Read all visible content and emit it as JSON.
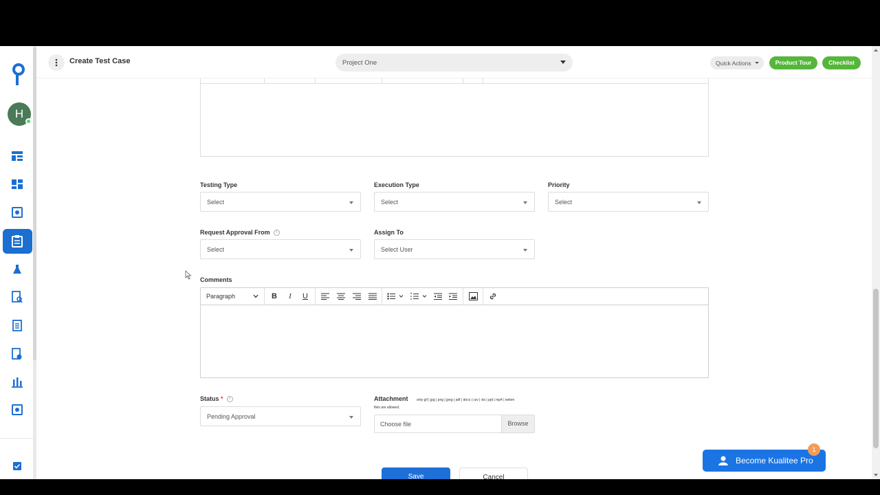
{
  "app": {
    "title": "Create Test Case",
    "avatar_initial": "H",
    "accent_color": "#1b6fd1",
    "green_color": "#55b63a"
  },
  "header": {
    "project": "Project One",
    "quick_actions": "Quick Actions",
    "product_tour": "Product Tour",
    "checklist": "Checklist"
  },
  "sidebar": {
    "icons": [
      "layout-icon",
      "dashboard-icon",
      "settings-doc-icon",
      "test-cases-icon",
      "flask-icon",
      "doc-search-icon",
      "clipboard-icon",
      "doc-edit-icon",
      "chart-icon",
      "gear-doc-icon",
      "checkbox-icon"
    ],
    "active": "test-cases-icon"
  },
  "form": {
    "testing_type": {
      "label": "Testing Type",
      "value": "Select"
    },
    "execution_type": {
      "label": "Execution Type",
      "value": "Select"
    },
    "priority": {
      "label": "Priority",
      "value": "Select"
    },
    "request_approval": {
      "label": "Request Approval From",
      "value": "Select"
    },
    "assign_to": {
      "label": "Assign To",
      "value": "Select User"
    },
    "comments": {
      "label": "Comments",
      "paragraph": "Paragraph"
    },
    "status": {
      "label": "Status",
      "required_mark": "*",
      "value": "Pending Approval"
    },
    "attachment": {
      "label": "Attachment",
      "hint_line1": "only gif | jpg | png | jpeg | pdf | docx | csv | xls | ppt | mp4 | webm",
      "hint_line2": "files are allowed.",
      "placeholder": "Choose file",
      "browse": "Browse"
    },
    "save": "Save",
    "cancel": "Cancel"
  },
  "promo": {
    "label": "Become Kualitee Pro",
    "badge": "1"
  }
}
